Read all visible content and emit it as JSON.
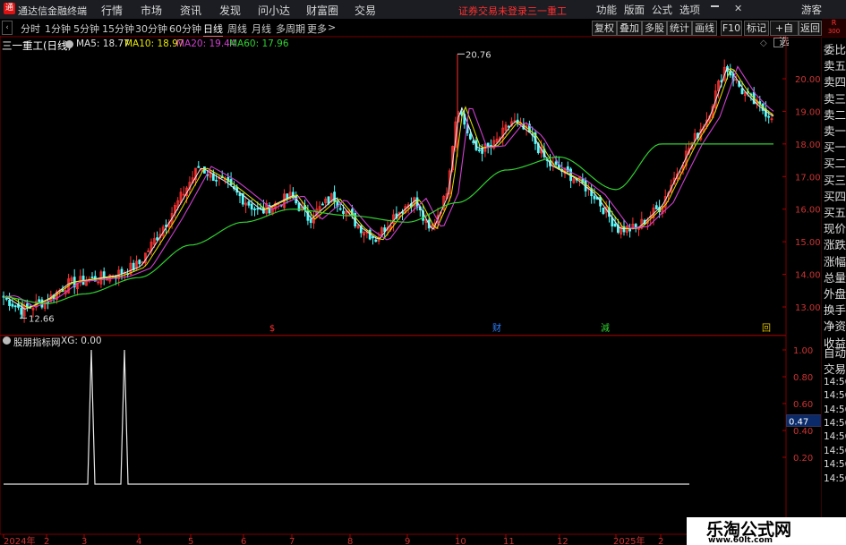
{
  "app": {
    "title": "通达信金融终端",
    "menu": [
      "行情",
      "市场",
      "资讯",
      "发现",
      "问小达",
      "财富圈",
      "交易"
    ],
    "alert": "证券交易未登录",
    "stock_title": "三一重工",
    "right_menu": [
      "功能",
      "版面",
      "公式",
      "选项"
    ],
    "guest": "游客",
    "badge_top": "R",
    "badge_bottom": "300"
  },
  "toolbar": {
    "periods": [
      "分时",
      "1分钟",
      "5分钟",
      "15分钟",
      "30分钟",
      "60分钟",
      "日线",
      "周线",
      "月线",
      "多周期",
      "更多"
    ],
    "active_period": "日线",
    "more_arrow": ">",
    "buttons": [
      "复权",
      "叠加",
      "多股",
      "统计",
      "画线",
      "F10",
      "标记",
      "+自选",
      "返回"
    ]
  },
  "main_chart": {
    "name": "三一重工(日线)",
    "ma_labels": [
      {
        "text": "MA5: 18.77",
        "color": "#e0e0e0"
      },
      {
        "text": "MA10: 18.97",
        "color": "#e6e600"
      },
      {
        "text": "MA20: 19.44",
        "color": "#d040d0"
      },
      {
        "text": "MA60: 17.96",
        "color": "#30d030"
      }
    ],
    "high_label": "20.76",
    "low_label": "12.66",
    "y_ticks": [
      "20.00",
      "19.00",
      "18.00",
      "17.00",
      "16.00",
      "15.00",
      "14.00",
      "13.00"
    ],
    "markers": [
      {
        "text": "$",
        "color": "#ff3030"
      },
      {
        "text": "财",
        "color": "#3080ff"
      },
      {
        "text": "減",
        "color": "#30d030"
      },
      {
        "text": "回",
        "color": "#e0c000"
      }
    ]
  },
  "sub_chart": {
    "name": "股朋指标网",
    "value_label": "XG: 0.00",
    "y_ticks": [
      "1.00",
      "0.80",
      "0.60",
      "0.40",
      "0.20"
    ],
    "cursor_value": "0.47"
  },
  "x_axis": [
    "2024年",
    "2",
    "3",
    "4",
    "5",
    "6",
    "7",
    "8",
    "9",
    "10",
    "11",
    "12",
    "2025年",
    "2"
  ],
  "side_panel": {
    "quote_rows": [
      "委比",
      "卖五",
      "卖四",
      "卖三",
      "卖二",
      "卖一",
      "买一",
      "买二",
      "买三",
      "买四",
      "买五",
      "现价",
      "涨跌",
      "涨幅",
      "总量",
      "外盘",
      "换手",
      "净资",
      "收益"
    ],
    "bottom_rows": [
      "自动",
      "交易",
      "14:56",
      "14:56",
      "14:56",
      "14:56",
      "14:56",
      "14:56",
      "14:56",
      "14:56"
    ]
  },
  "watermark": {
    "title": "乐淘公式网",
    "url": "www.60lt.com"
  },
  "chart_data": {
    "type": "candlestick",
    "ylim": [
      12.4,
      21.0
    ],
    "x": [
      "2024-01",
      "2024-02",
      "2024-03",
      "2024-04",
      "2024-05",
      "2024-06",
      "2024-07",
      "2024-08",
      "2024-09",
      "2024-10",
      "2024-11",
      "2024-12",
      "2025-01",
      "2025-02"
    ],
    "close_by_month": [
      13.2,
      13.4,
      13.9,
      14.3,
      17.0,
      16.0,
      16.3,
      15.1,
      15.6,
      18.0,
      18.6,
      17.2,
      15.6,
      18.9
    ],
    "ma60_series": [
      13.3,
      13.1,
      13.4,
      13.9,
      14.9,
      15.6,
      16.0,
      15.8,
      15.6,
      16.2,
      17.2,
      17.6,
      16.6,
      18.0
    ],
    "indicator_xg": {
      "name": "XG",
      "spikes_at": [
        "2024-03",
        "2024-04"
      ],
      "value": 1.0
    }
  }
}
